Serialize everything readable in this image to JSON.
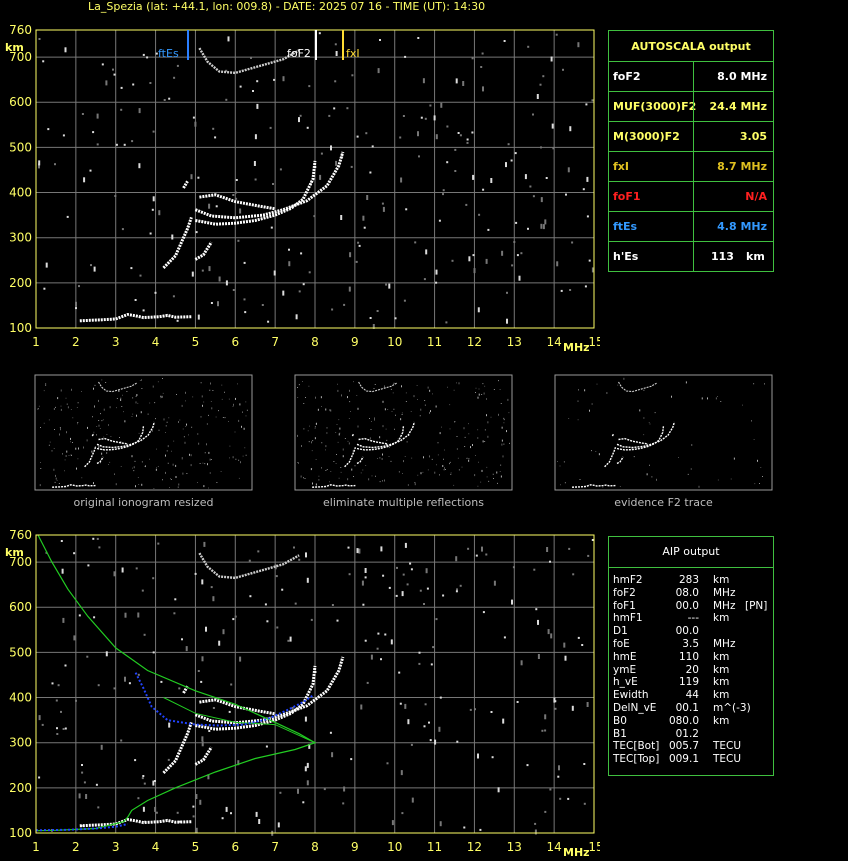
{
  "header": {
    "title": "La_Spezia (lat: +44.1, lon: 009.8) - DATE: 2025 07 16 - TIME (UT): 14:30"
  },
  "axes": {
    "y_unit": "km",
    "x_unit": "MHz",
    "y_ticks": [
      "760",
      "700",
      "600",
      "500",
      "400",
      "300",
      "200",
      "100"
    ],
    "x_ticks": [
      "1",
      "2",
      "3",
      "4",
      "5",
      "6",
      "7",
      "8",
      "9",
      "10",
      "11",
      "12",
      "13",
      "14",
      "15"
    ]
  },
  "markers": {
    "ftEs": "ftEs",
    "foF2": "foF2",
    "fxI": "fxI"
  },
  "autoscala": {
    "title": "AUTOSCALA output",
    "rows": [
      {
        "label": "foF2",
        "value": "8.0 MHz",
        "color": "#ffffff"
      },
      {
        "label": "MUF(3000)F2",
        "value": "24.4 MHz",
        "color": "#ffff66"
      },
      {
        "label": "M(3000)F2",
        "value": "3.05",
        "color": "#ffff66"
      },
      {
        "label": "fxI",
        "value": "8.7 MHz",
        "color": "#e0c020"
      },
      {
        "label": "foF1",
        "value": "N/A",
        "color": "#ff2020"
      },
      {
        "label": "ftEs",
        "value": "4.8 MHz",
        "color": "#3399ff"
      },
      {
        "label": "h'Es",
        "value": "113",
        "unit": "km",
        "color": "#ffffff"
      }
    ]
  },
  "thumbnails": {
    "captions": [
      "original ionogram resized",
      "eliminate multiple reflections",
      "evidence F2 trace"
    ]
  },
  "aip": {
    "title": "AIP output",
    "rows": [
      [
        "hmF2",
        "283",
        "km",
        ""
      ],
      [
        "foF2",
        "08.0",
        "MHz",
        ""
      ],
      [
        "foF1",
        "00.0",
        "MHz",
        "[PN]"
      ],
      [
        "hmF1",
        "---",
        "km",
        ""
      ],
      [
        "D1",
        "00.0",
        "",
        ""
      ],
      [
        "foE",
        "3.5",
        "MHz",
        ""
      ],
      [
        "hmE",
        "110",
        "km",
        ""
      ],
      [
        "ymE",
        "20",
        "km",
        ""
      ],
      [
        "h_vE",
        "119",
        "km",
        ""
      ],
      [
        "Ewidth",
        "44",
        "km",
        ""
      ],
      [
        "DelN_vE",
        "00.1",
        "m^(-3)",
        ""
      ],
      [
        "B0",
        "080.0",
        "km",
        ""
      ],
      [
        "B1",
        "01.2",
        "",
        ""
      ],
      [
        "TEC[Bot]",
        "005.7",
        "TECU",
        ""
      ],
      [
        "TEC[Top]",
        "009.1",
        "TECU",
        ""
      ]
    ]
  }
}
